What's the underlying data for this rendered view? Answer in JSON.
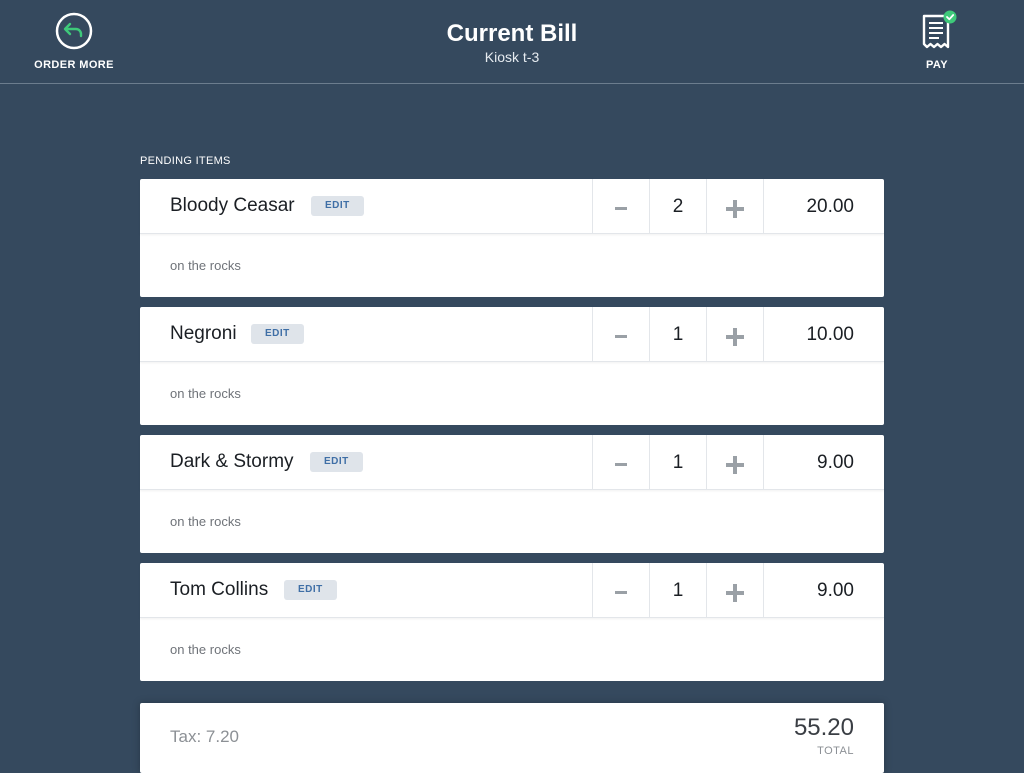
{
  "header": {
    "title": "Current Bill",
    "subtitle": "Kiosk t-3",
    "order_more_label": "ORDER MORE",
    "pay_label": "PAY",
    "icons": {
      "order_more": "back-arrow-circle-icon",
      "pay": "receipt-check-icon"
    }
  },
  "section_label": "PENDING ITEMS",
  "items": [
    {
      "name": "Bloody Ceasar",
      "edit_label": "EDIT",
      "minus": "-",
      "qty": "2",
      "plus": "+",
      "price": "20.00",
      "note": "on the rocks"
    },
    {
      "name": "Negroni",
      "edit_label": "EDIT",
      "minus": "-",
      "qty": "1",
      "plus": "+",
      "price": "10.00",
      "note": "on the rocks"
    },
    {
      "name": "Dark & Stormy",
      "edit_label": "EDIT",
      "minus": "-",
      "qty": "1",
      "plus": "+",
      "price": "9.00",
      "note": "on the rocks"
    },
    {
      "name": "Tom Collins",
      "edit_label": "EDIT",
      "minus": "-",
      "qty": "1",
      "plus": "+",
      "price": "9.00",
      "note": "on the rocks"
    }
  ],
  "summary": {
    "tax": "Tax: 7.20",
    "total": "55.20",
    "total_label": "TOTAL"
  },
  "colors": {
    "background": "#35495e",
    "card": "#ffffff",
    "accent_green": "#3ec97a",
    "edit_text": "#3f6fa6"
  }
}
